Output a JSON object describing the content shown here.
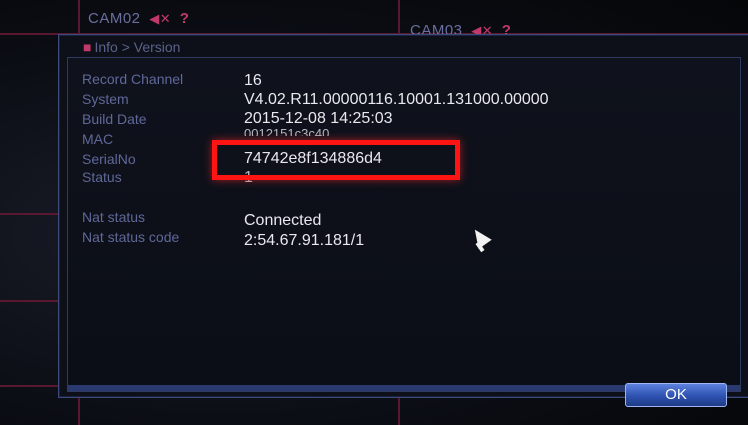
{
  "cameras": {
    "cam02": {
      "label": "CAM02",
      "icon": "speaker-muted-icon",
      "status": "?"
    },
    "cam03": {
      "label": "CAM03",
      "icon": "speaker-muted-icon",
      "status": "?"
    }
  },
  "dialog": {
    "breadcrumb": "Info > Version",
    "fields": [
      {
        "label": "Record Channel",
        "value": "16"
      },
      {
        "label": "System",
        "value": "V4.02.R11.00000116.10001.131000.00000"
      },
      {
        "label": "Build Date",
        "value": "2015-12-08 14:25:03"
      },
      {
        "label": "MAC",
        "value": "0012151c3c40"
      },
      {
        "label": "SerialNo",
        "value": "74742e8f134886d4"
      },
      {
        "label": "Status",
        "value": "1"
      },
      {
        "label": "Nat status",
        "value": "Connected"
      },
      {
        "label": "Nat status code",
        "value": "2:54.67.91.181/1"
      }
    ],
    "ok_label": "OK"
  },
  "colors": {
    "highlight": "#ff1414",
    "label_text": "#5f6898",
    "value_text": "#e8e8ee",
    "accent": "#c0396a"
  }
}
